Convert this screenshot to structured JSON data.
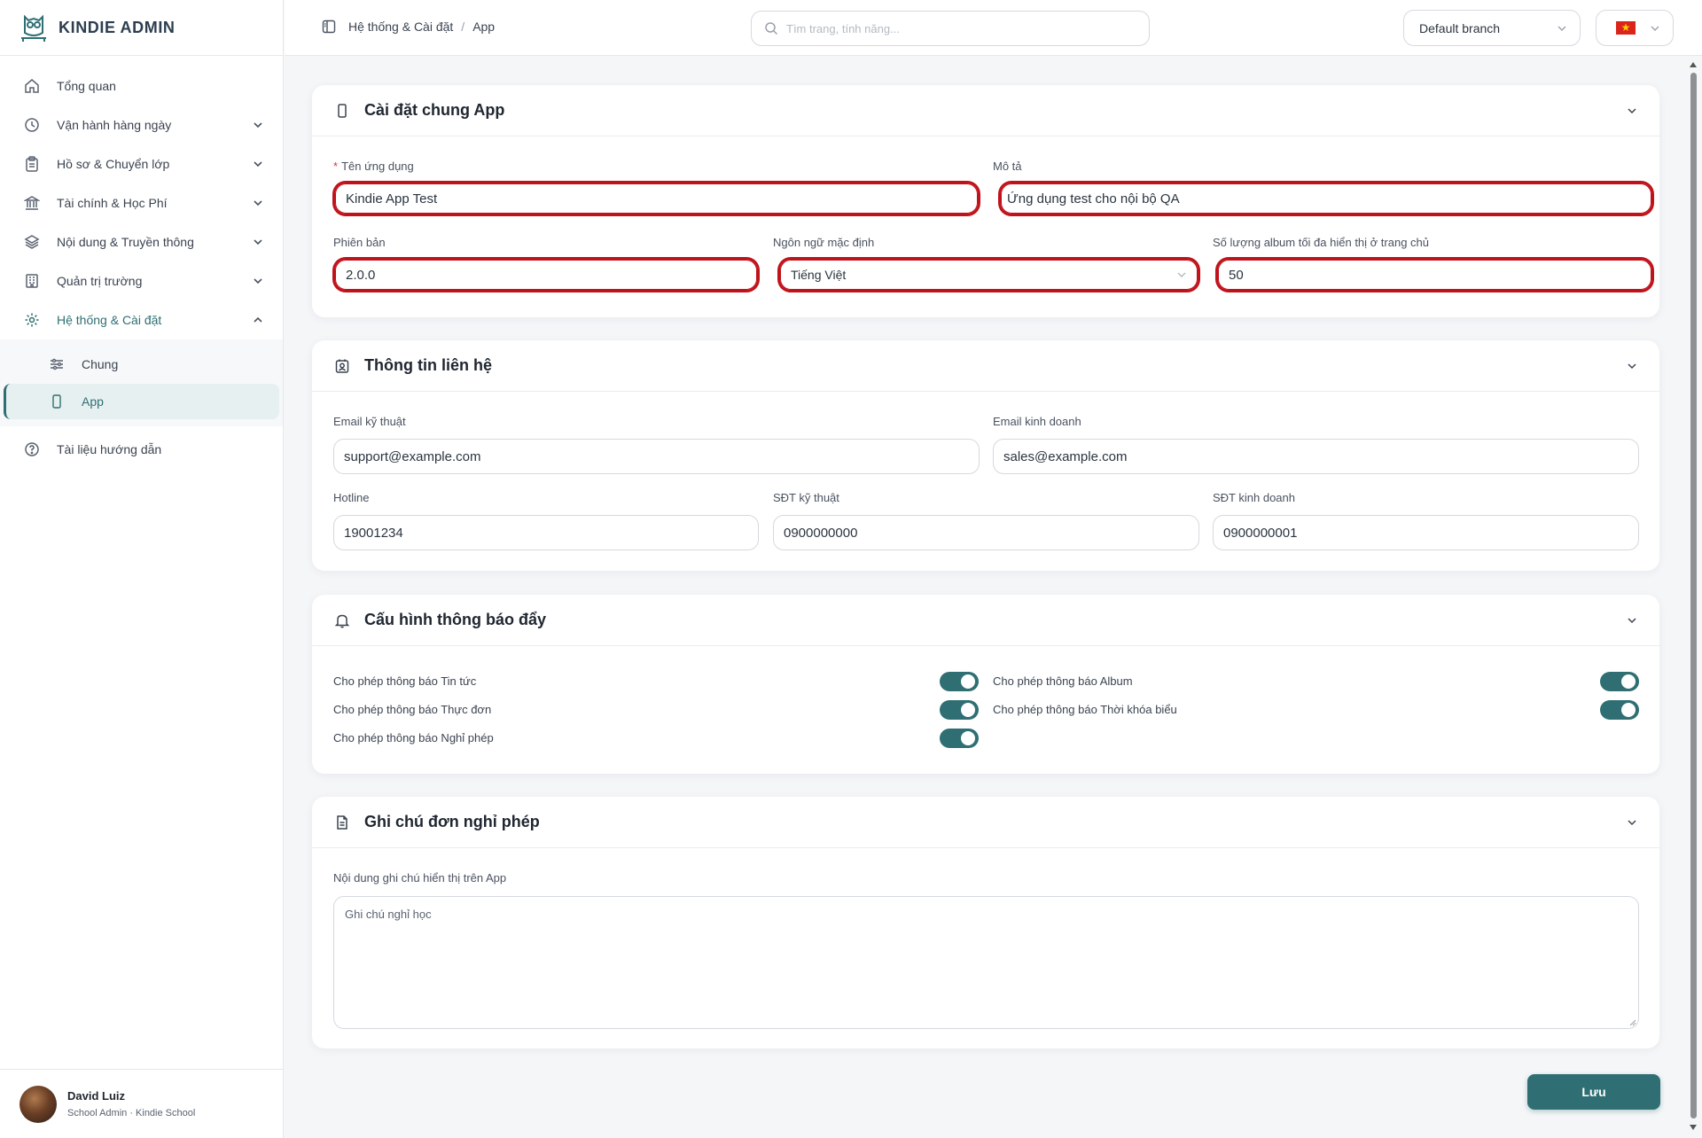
{
  "app": {
    "brand": "KINDIE ADMIN"
  },
  "sidebar": {
    "items": [
      {
        "label": "Tổng quan",
        "icon": "home-icon"
      },
      {
        "label": "Vận hành hàng ngày",
        "icon": "clock-icon"
      },
      {
        "label": "Hồ sơ & Chuyển lớp",
        "icon": "clipboard-icon"
      },
      {
        "label": "Tài chính & Học Phí",
        "icon": "bank-icon"
      },
      {
        "label": "Nội dung & Truyền thông",
        "icon": "layers-icon"
      },
      {
        "label": "Quản trị trường",
        "icon": "building-icon"
      },
      {
        "label": "Hệ thống & Cài đặt",
        "icon": "gear-icon"
      },
      {
        "label": "Tài liệu hướng dẫn",
        "icon": "help-icon"
      }
    ],
    "sub_items": [
      {
        "label": "Chung",
        "icon": "sliders-icon"
      },
      {
        "label": "App",
        "icon": "phone-icon"
      }
    ]
  },
  "user": {
    "name": "David Luiz",
    "role": "School Admin · Kindie School"
  },
  "header": {
    "breadcrumb": [
      "Hệ thống & Cài đặt",
      "App"
    ],
    "search_placeholder": "Tìm trang, tính năng...",
    "branch": "Default branch"
  },
  "general": {
    "title": "Cài đặt chung App",
    "app_name_label": "Tên ứng dụng",
    "app_name": "Kindie App Test",
    "description_label": "Mô tả",
    "description": "Ứng dụng test cho nội bộ QA",
    "version_label": "Phiên bản",
    "version": "2.0.0",
    "language_label": "Ngôn ngữ mặc định",
    "language": "Tiếng Việt",
    "album_label": "Số lượng album tối đa hiển thị ở trang chủ",
    "album_count": "50"
  },
  "contact": {
    "title": "Thông tin liên hệ",
    "tech_email_label": "Email kỹ thuật",
    "tech_email": "support@example.com",
    "sales_email_label": "Email kinh doanh",
    "sales_email": "sales@example.com",
    "hotline_label": "Hotline",
    "hotline": "19001234",
    "tech_phone_label": "SĐT kỹ thuật",
    "tech_phone": "0900000000",
    "sales_phone_label": "SĐT kinh doanh",
    "sales_phone": "0900000001"
  },
  "push": {
    "title": "Cấu hình thông báo đẩy",
    "news": "Cho phép thông báo Tin tức",
    "menu": "Cho phép thông báo Thực đơn",
    "leave": "Cho phép thông báo Nghỉ phép",
    "album": "Cho phép thông báo Album",
    "timetable": "Cho phép thông báo Thời khóa biểu",
    "toggles_on": true
  },
  "leave_note": {
    "title": "Ghi chú đơn nghỉ phép",
    "label": "Nội dung ghi chú hiển thị trên App",
    "value": "Ghi chú nghỉ học"
  },
  "actions": {
    "save": "Lưu"
  },
  "colors": {
    "accent": "#2f6f73",
    "highlight": "#c0121b"
  }
}
